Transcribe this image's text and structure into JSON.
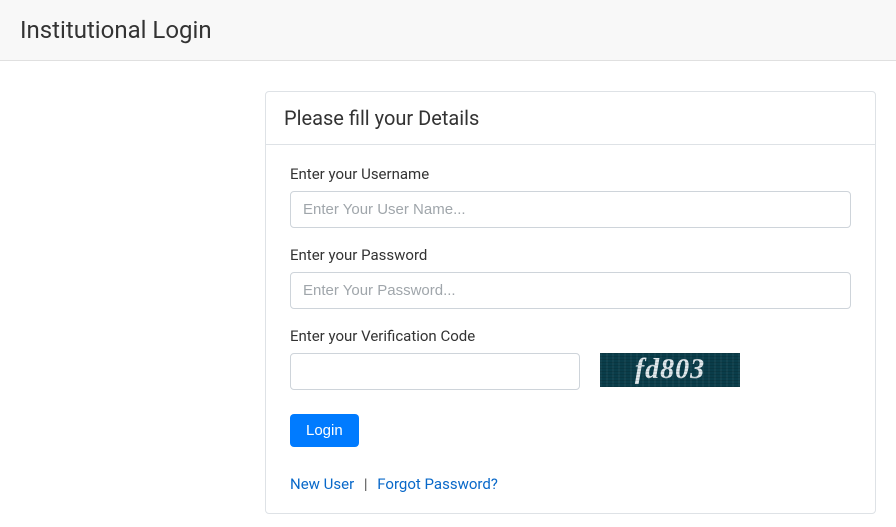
{
  "header": {
    "title": "Institutional Login"
  },
  "card": {
    "title": "Please fill your Details"
  },
  "form": {
    "username_label": "Enter your Username",
    "username_placeholder": "Enter Your User Name...",
    "username_value": "",
    "password_label": "Enter your Password",
    "password_placeholder": "Enter Your Password...",
    "password_value": "",
    "verification_label": "Enter your Verification Code",
    "verification_value": "",
    "captcha_text": "fd803",
    "login_button": "Login"
  },
  "links": {
    "new_user": "New User",
    "separator": "|",
    "forgot_password": "Forgot Password?"
  }
}
